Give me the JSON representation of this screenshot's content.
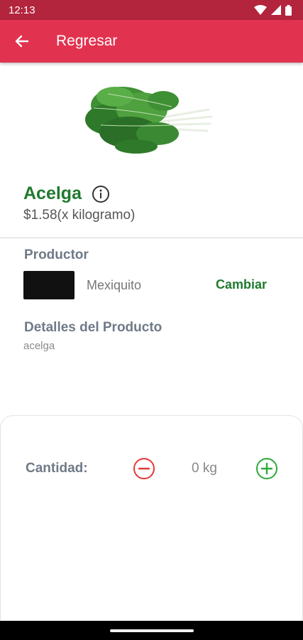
{
  "status_bar": {
    "time": "12:13"
  },
  "app_bar": {
    "title": "Regresar"
  },
  "product": {
    "name": "Acelga",
    "price": "$1.58(x kilogramo)",
    "image_icon": "chard-leaves-image"
  },
  "producer": {
    "section_title": "Productor",
    "name": "Mexiquito",
    "change_label": "Cambiar"
  },
  "details": {
    "section_title": "Detalles del Producto",
    "text": "acelga"
  },
  "quantity": {
    "label": "Cantidad:",
    "value": "0 kg"
  },
  "colors": {
    "brand": "#e1324f",
    "status_bar": "#b3243d",
    "accent_green": "#1f7a2e",
    "minus_red": "#e53935",
    "plus_green": "#2eaa3a"
  }
}
